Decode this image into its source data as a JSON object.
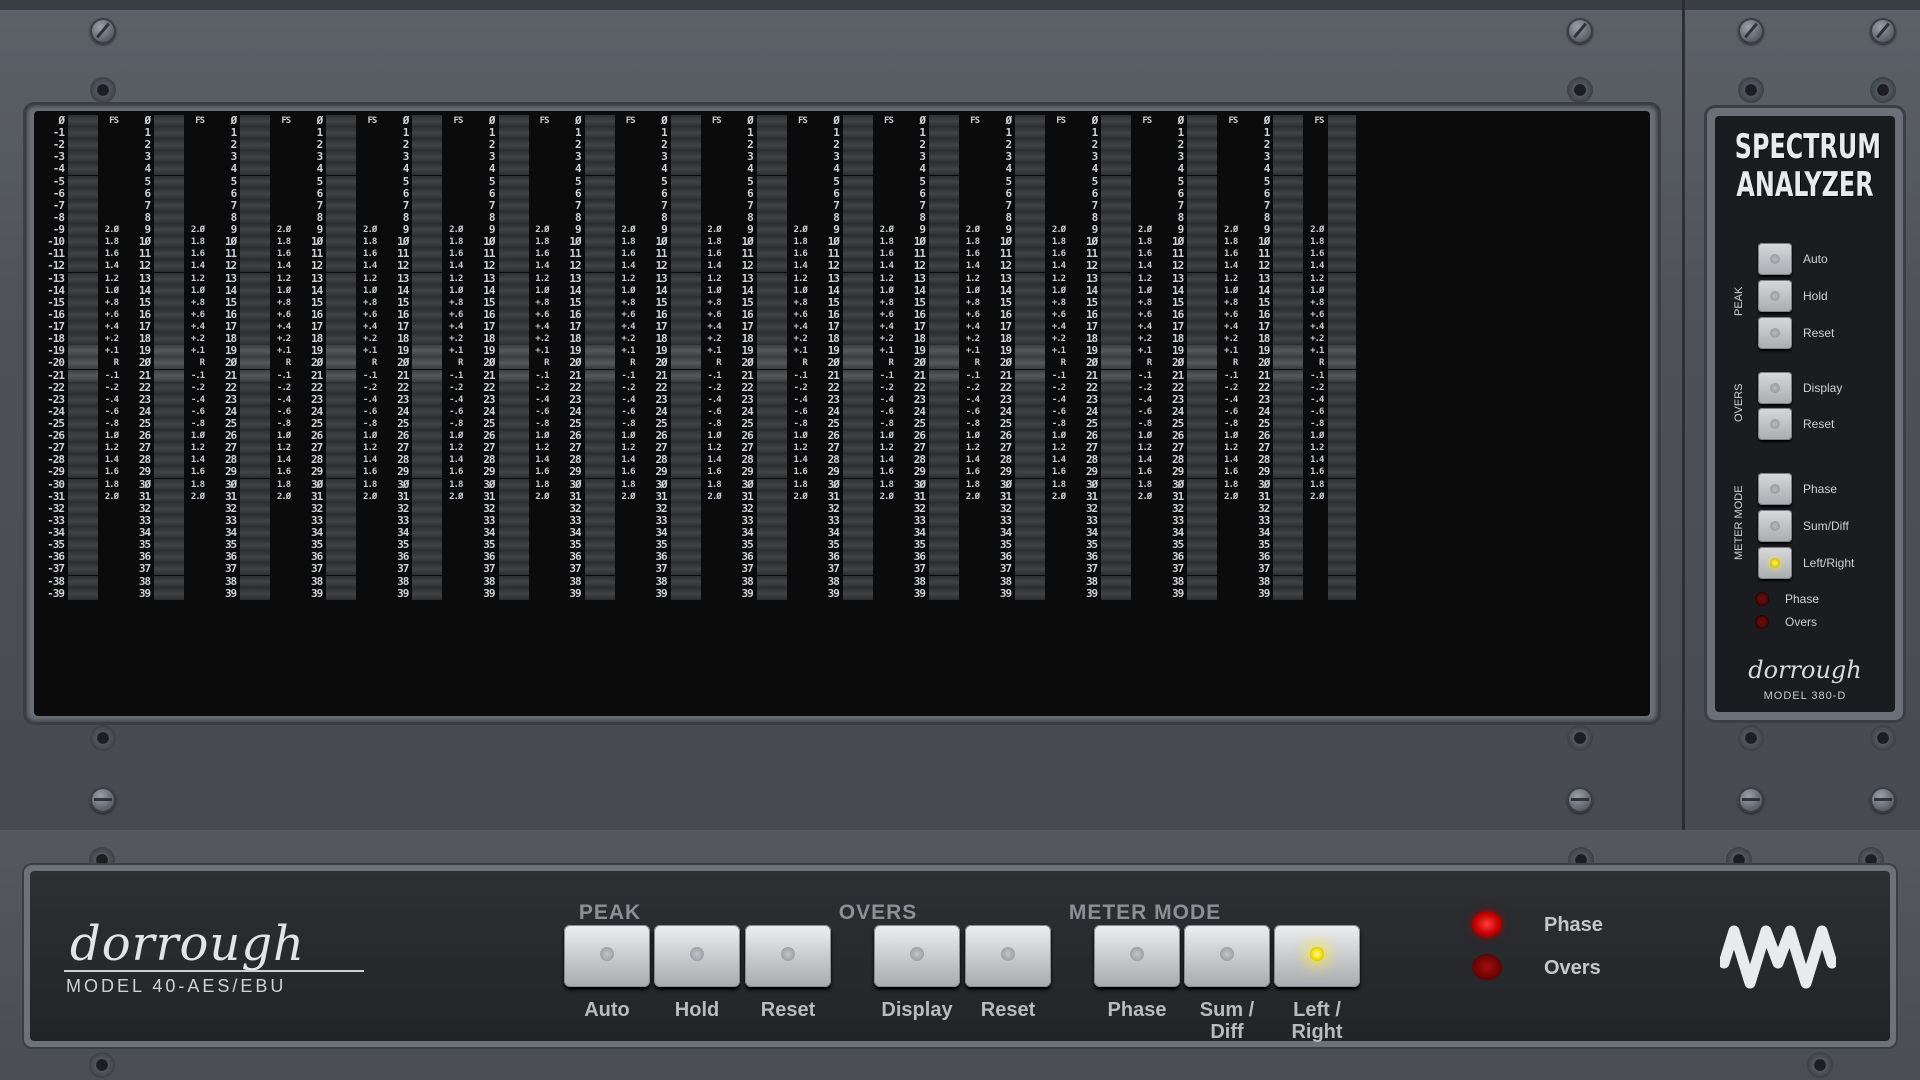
{
  "side_panel": {
    "title_line1": "SPECTRUM",
    "title_line2": "ANALYZER",
    "peak_group": "PEAK",
    "overs_group": "OVERS",
    "meter_mode_group": "METER MODE",
    "buttons": {
      "auto": "Auto",
      "hold": "Hold",
      "peak_reset": "Reset",
      "display": "Display",
      "overs_reset": "Reset",
      "phase": "Phase",
      "sum_diff": "Sum/Diff",
      "left_right": "Left/Right"
    },
    "leds": {
      "phase": "Phase",
      "overs": "Overs"
    },
    "brand": "dorrough",
    "model": "MODEL 380-D"
  },
  "meter": {
    "scale_top": "Ø",
    "fs_label": "FS",
    "center_label": "R",
    "scale_ticks": [
      "Ø",
      "-1",
      "-2",
      "-3",
      "-4",
      "-5",
      "-6",
      "-7",
      "-8",
      "-9",
      "-10",
      "-11",
      "-12",
      "-13",
      "-14",
      "-15",
      "-16",
      "-17",
      "-18",
      "-19",
      "-20",
      "-21",
      "-22",
      "-23",
      "-24",
      "-25",
      "-26",
      "-27",
      "-28",
      "-29",
      "-30",
      "-31",
      "-32",
      "-33",
      "-34",
      "-35",
      "-36",
      "-37",
      "-38",
      "-39"
    ],
    "channel_ticks": [
      "Ø",
      "1",
      "2",
      "3",
      "4",
      "5",
      "6",
      "7",
      "8",
      "9",
      "1Ø",
      "11",
      "12",
      "13",
      "14",
      "15",
      "16",
      "17",
      "18",
      "19",
      "2Ø",
      "21",
      "22",
      "23",
      "24",
      "25",
      "26",
      "27",
      "28",
      "29",
      "3Ø",
      "31",
      "32",
      "33",
      "34",
      "35",
      "36",
      "37",
      "38",
      "39"
    ],
    "phase_ticks": [
      "2.Ø",
      "1.8",
      "1.6",
      "1.4",
      "1.2",
      "1.Ø",
      "+.8",
      "+.6",
      "+.4",
      "+.2",
      "+.1",
      "R",
      "-.1",
      "-.2",
      "-.4",
      "-.6",
      "-.8",
      "1.Ø",
      "1.2",
      "1.4",
      "1.6",
      "1.8",
      "2.Ø"
    ]
  },
  "controls": {
    "brand": "dorrough",
    "model": "MODEL 40-AES/EBU",
    "peak": {
      "title": "PEAK",
      "auto": "Auto",
      "hold": "Hold",
      "reset": "Reset"
    },
    "overs": {
      "title": "OVERS",
      "display": "Display",
      "reset": "Reset"
    },
    "meter_mode": {
      "title": "METER MODE",
      "phase": "Phase",
      "sum_diff_line1": "Sum /",
      "sum_diff_line2": "Diff",
      "left_right_line1": "Left /",
      "left_right_line2": "Right",
      "active": "left_right"
    },
    "leds": {
      "phase": "Phase",
      "overs": "Overs"
    }
  },
  "colors": {
    "lit_button": "#ffe54a",
    "led_red": "#d40000",
    "panel": "#4e5258"
  }
}
